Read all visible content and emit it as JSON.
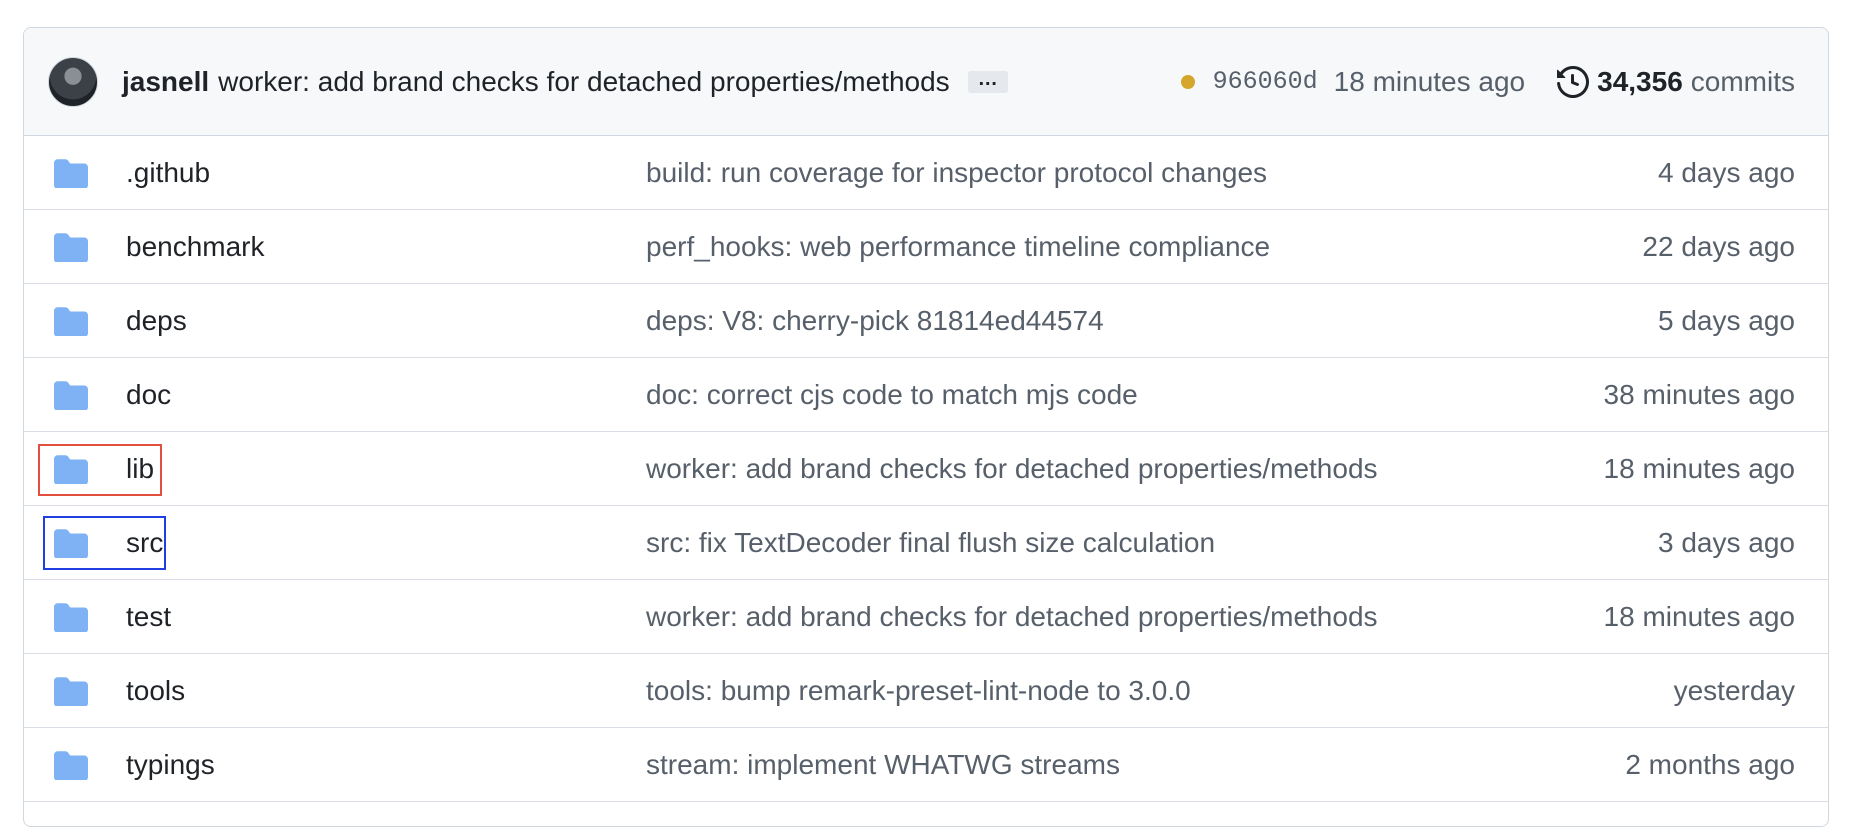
{
  "commit_header": {
    "author": "jasnell",
    "message": "worker: add brand checks for detached properties/methods",
    "ellipsis": "…",
    "sha": "966060d",
    "time": "18 minutes ago",
    "commit_count": "34,356",
    "commits_label": "commits"
  },
  "colors": {
    "folder": "#7fb2f5",
    "status_pending": "#d4a72c",
    "highlight_red": "#e0503c",
    "highlight_blue": "#1f3fe0"
  },
  "files": [
    {
      "name": ".github",
      "message": "build: run coverage for inspector protocol changes",
      "time": "4 days ago",
      "icon": "folder-icon"
    },
    {
      "name": "benchmark",
      "message": "perf_hooks: web performance timeline compliance",
      "time": "22 days ago",
      "icon": "folder-icon"
    },
    {
      "name": "deps",
      "message": "deps: V8: cherry-pick 81814ed44574",
      "time": "5 days ago",
      "icon": "folder-icon"
    },
    {
      "name": "doc",
      "message": "doc: correct cjs code to match mjs code",
      "time": "38 minutes ago",
      "icon": "folder-icon"
    },
    {
      "name": "lib",
      "message": "worker: add brand checks for detached properties/methods",
      "time": "18 minutes ago",
      "icon": "folder-icon"
    },
    {
      "name": "src",
      "message": "src: fix TextDecoder final flush size calculation",
      "time": "3 days ago",
      "icon": "folder-icon"
    },
    {
      "name": "test",
      "message": "worker: add brand checks for detached properties/methods",
      "time": "18 minutes ago",
      "icon": "folder-icon"
    },
    {
      "name": "tools",
      "message": "tools: bump remark-preset-lint-node to 3.0.0",
      "time": "yesterday",
      "icon": "folder-icon"
    },
    {
      "name": "typings",
      "message": "stream: implement WHATWG streams",
      "time": "2 months ago",
      "icon": "folder-icon"
    }
  ]
}
